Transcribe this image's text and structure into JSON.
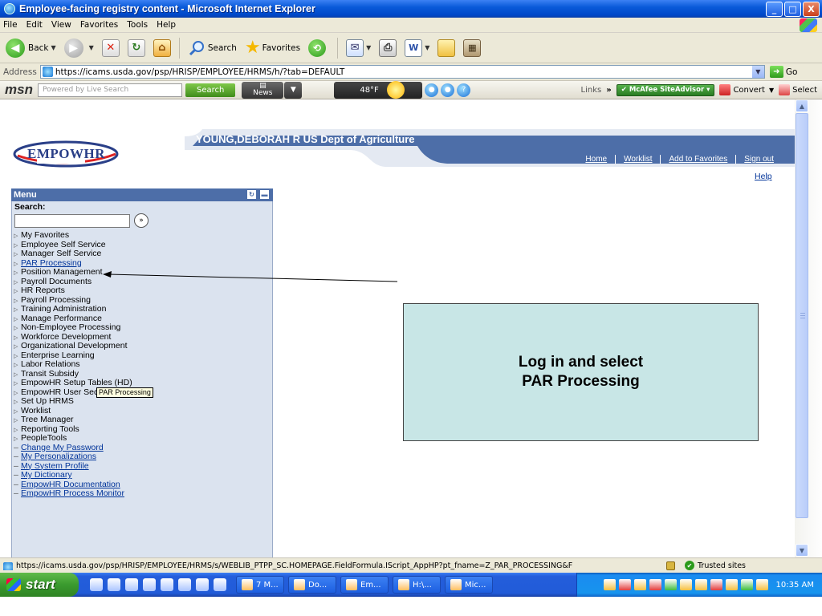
{
  "window": {
    "title": "Employee-facing registry content - Microsoft Internet Explorer",
    "controls": [
      "_",
      "□",
      "X"
    ]
  },
  "menubar": [
    "File",
    "Edit",
    "View",
    "Favorites",
    "Tools",
    "Help"
  ],
  "toolbar": {
    "back": "Back",
    "search": "Search",
    "favorites": "Favorites"
  },
  "address": {
    "label": "Address",
    "url": "https://icams.usda.gov/psp/HRISP/EMPLOYEE/HRMS/h/?tab=DEFAULT",
    "go": "Go"
  },
  "msn": {
    "logo": "msn",
    "search_placeholder": "Powered by Live Search",
    "search_button": "Search",
    "news": "News",
    "temperature": "48°F",
    "links": "Links",
    "mcafee": "McAfee SiteAdvisor",
    "convert": "Convert",
    "select": "Select"
  },
  "header": {
    "user": "YOUNG,DEBORAH R  US Dept of Agriculture",
    "logo_text": "EMPOWHR",
    "nav": [
      "Home",
      "Worklist",
      "Add to Favorites",
      "Sign out"
    ],
    "help": "Help"
  },
  "menu": {
    "title": "Menu",
    "search_label": "Search:",
    "items": [
      {
        "label": "My Favorites",
        "type": "folder"
      },
      {
        "label": "Employee Self Service",
        "type": "folder"
      },
      {
        "label": "Manager Self Service",
        "type": "folder"
      },
      {
        "label": "PAR Processing",
        "type": "folder-link"
      },
      {
        "label": "Position Management",
        "type": "folder"
      },
      {
        "label": "Payroll Documents",
        "type": "folder"
      },
      {
        "label": "HR Reports",
        "type": "folder"
      },
      {
        "label": "Payroll Processing",
        "type": "folder"
      },
      {
        "label": "Training Administration",
        "type": "folder"
      },
      {
        "label": "Manage Performance",
        "type": "folder"
      },
      {
        "label": "Non-Employee Processing",
        "type": "folder"
      },
      {
        "label": "Workforce Development",
        "type": "folder"
      },
      {
        "label": "Organizational Development",
        "type": "folder"
      },
      {
        "label": "Enterprise Learning",
        "type": "folder"
      },
      {
        "label": "Labor Relations",
        "type": "folder"
      },
      {
        "label": "Transit Subsidy",
        "type": "folder"
      },
      {
        "label": "EmpowHR Setup Tables (HD)",
        "type": "folder"
      },
      {
        "label": "EmpowHR User Security (HD)",
        "type": "folder"
      },
      {
        "label": "Set Up HRMS",
        "type": "folder"
      },
      {
        "label": "Worklist",
        "type": "folder"
      },
      {
        "label": "Tree Manager",
        "type": "folder"
      },
      {
        "label": "Reporting Tools",
        "type": "folder"
      },
      {
        "label": "PeopleTools",
        "type": "folder"
      },
      {
        "label": "Change My Password",
        "type": "link"
      },
      {
        "label": "My Personalizations",
        "type": "link"
      },
      {
        "label": "My System Profile",
        "type": "link"
      },
      {
        "label": "My Dictionary",
        "type": "link"
      },
      {
        "label": "EmpowHR Documentation",
        "type": "link"
      },
      {
        "label": "EmpowHR Process Monitor",
        "type": "link"
      }
    ],
    "tooltip": "PAR Processing"
  },
  "callout": {
    "line1": "Log in and select",
    "line2": "PAR Processing"
  },
  "status": {
    "url": "https://icams.usda.gov/psp/HRISP/EMPLOYEE/HRMS/s/WEBLIB_PTPP_SC.HOMEPAGE.FieldFormula.IScript_AppHP?pt_fname=Z_PAR_PROCESSING&F",
    "zone": "Trusted sites"
  },
  "taskbar": {
    "start": "start",
    "tasks": [
      "7 M...",
      "Do...",
      "Em...",
      "H:\\...",
      "Mic..."
    ],
    "clock": "10:35 AM"
  }
}
